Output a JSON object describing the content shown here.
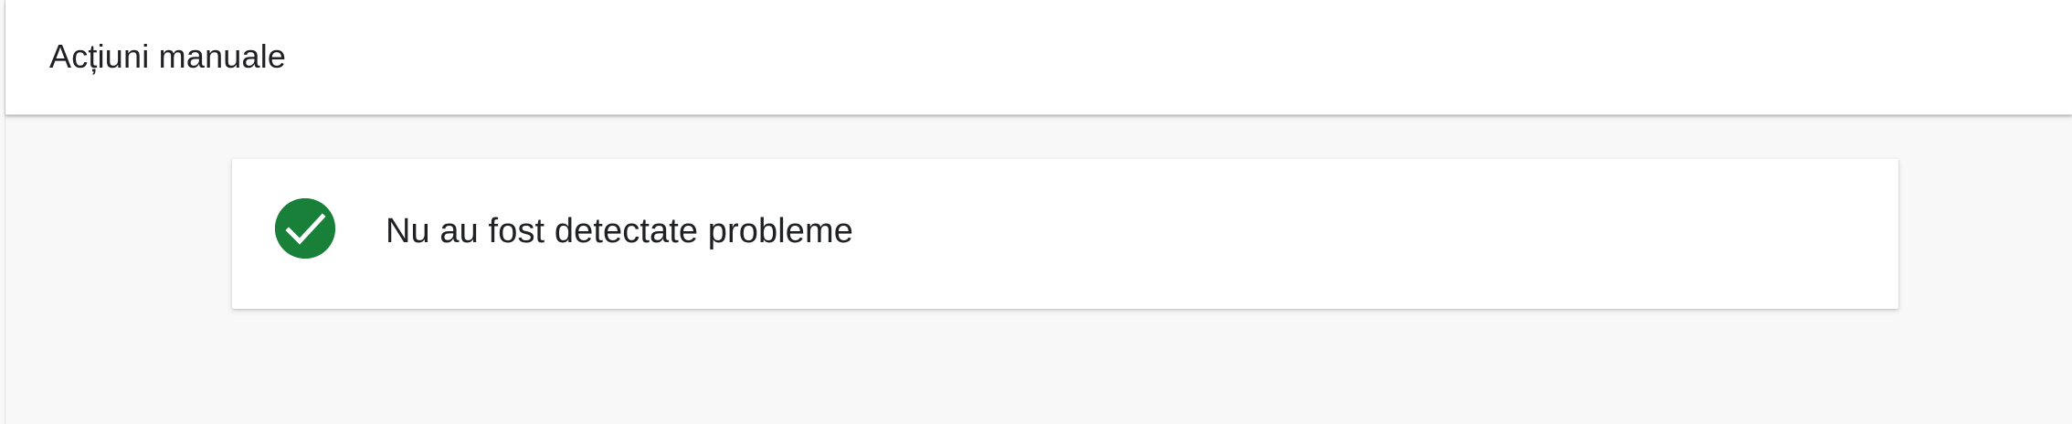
{
  "header": {
    "title": "Acțiuni manuale"
  },
  "status": {
    "message": "Nu au fost detectate probleme",
    "icon": "check-circle-icon",
    "icon_color": "#188038"
  },
  "colors": {
    "page_background": "#f8f8f8",
    "surface": "#ffffff",
    "text": "#202124"
  }
}
